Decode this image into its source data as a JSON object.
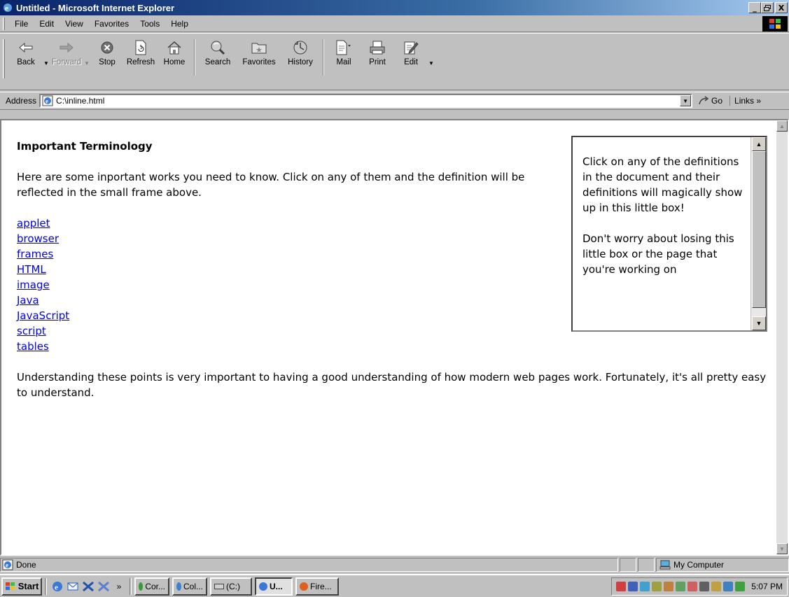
{
  "window": {
    "title": "Untitled - Microsoft Internet Explorer",
    "min_label": "_",
    "max_label": "Έ",
    "close_label": "X"
  },
  "menu": {
    "items": [
      {
        "label": "File"
      },
      {
        "label": "Edit"
      },
      {
        "label": "View"
      },
      {
        "label": "Favorites"
      },
      {
        "label": "Tools"
      },
      {
        "label": "Help"
      }
    ]
  },
  "toolbar": {
    "back": "Back",
    "forward": "Forward",
    "stop": "Stop",
    "refresh": "Refresh",
    "home": "Home",
    "search": "Search",
    "favorites": "Favorites",
    "history": "History",
    "mail": "Mail",
    "print": "Print",
    "edit": "Edit"
  },
  "address": {
    "label": "Address",
    "value": "C:\\inline.html",
    "go": "Go",
    "links": "Links »"
  },
  "page": {
    "heading": "Important Terminology",
    "intro": "Here are some inportant works you need to know. Click on any of them and the definition will be reflected in the small frame above.",
    "links": [
      "applet",
      "browser",
      "frames",
      "HTML",
      "image",
      "Java",
      "JavaScript",
      "script",
      "tables"
    ],
    "outro": "Understanding these points is very important to having a good understanding of how modern web pages work. Fortunately, it's all pretty easy to understand."
  },
  "inline_frame": {
    "para1": "Click on any of the definitions in the document and their definitions will magically show up in this little box!",
    "para2": "Don't worry about losing this little box or the page that you're working on"
  },
  "status": {
    "text": "Done",
    "zone": "My Computer"
  },
  "taskbar": {
    "start": "Start",
    "more": "»",
    "tasks": [
      {
        "label": "Cor..."
      },
      {
        "label": "Col..."
      },
      {
        "label": "(C:)"
      },
      {
        "label": "U..."
      },
      {
        "label": "Fire..."
      }
    ],
    "clock": "5:07 PM"
  },
  "colors": {
    "link": "#0000ee",
    "titlebar": "#0a246a",
    "chrome": "#c0c0c0"
  }
}
